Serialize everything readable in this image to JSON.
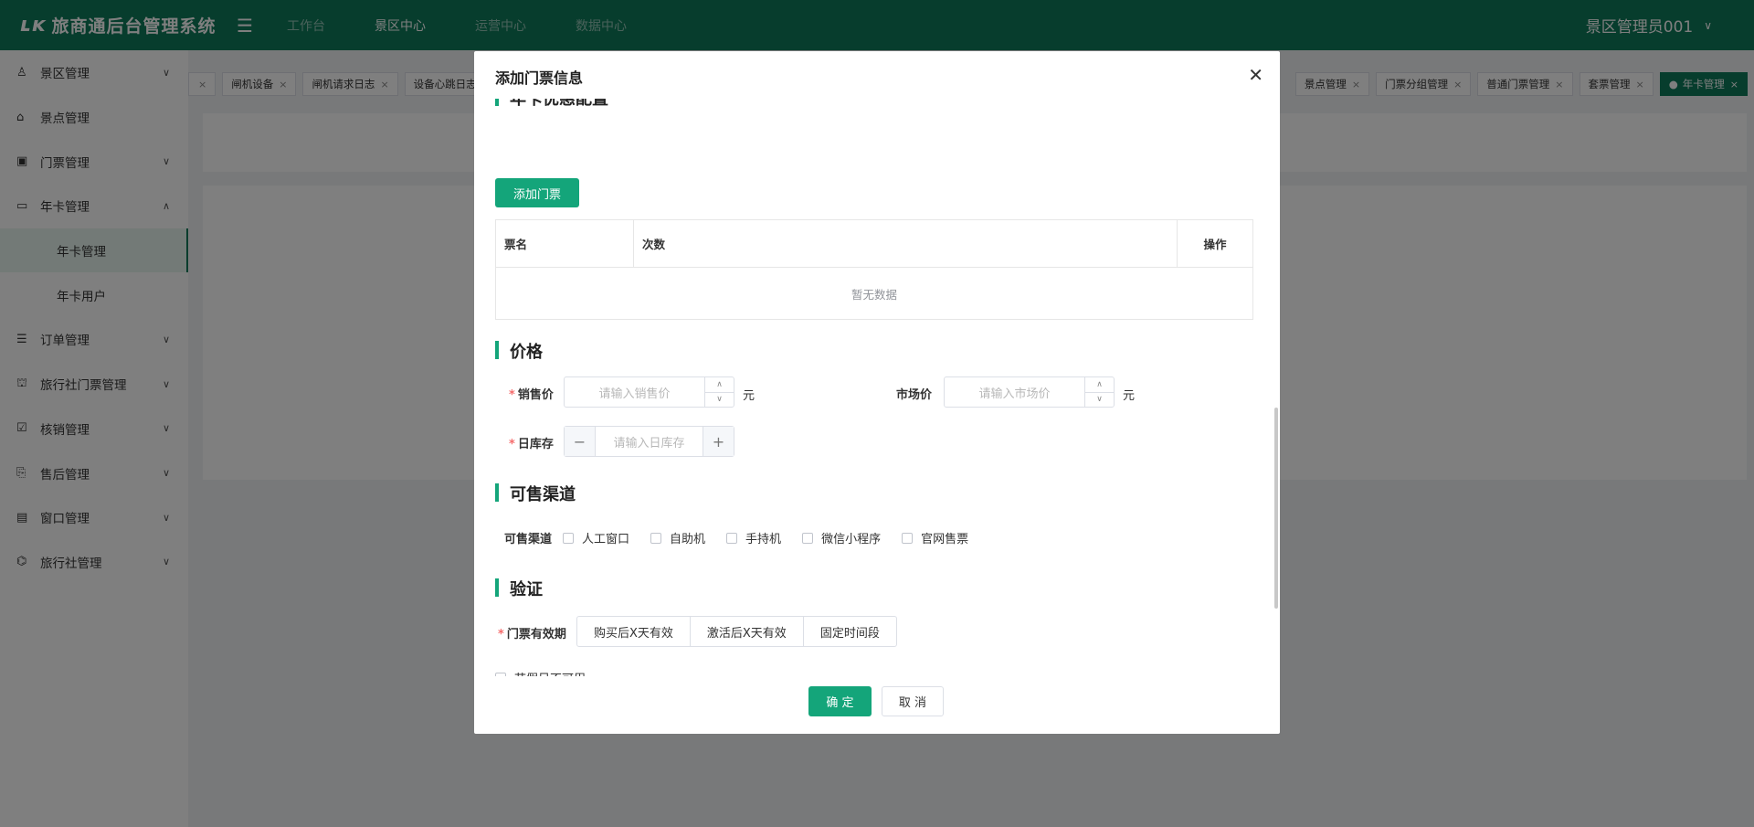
{
  "header": {
    "logo_mark": "ʟᴋ",
    "title": "旅商通后台管理系统",
    "nav": [
      "工作台",
      "景区中心",
      "运营中心",
      "数据中心"
    ],
    "user": "景区管理员001"
  },
  "sidebar": {
    "items": [
      {
        "label": "景区管理"
      },
      {
        "label": "景点管理"
      },
      {
        "label": "门票管理"
      },
      {
        "label": "年卡管理"
      },
      {
        "label": "年卡管理"
      },
      {
        "label": "年卡用户"
      },
      {
        "label": "订单管理"
      },
      {
        "label": "旅行社门票管理"
      },
      {
        "label": "核销管理"
      },
      {
        "label": "售后管理"
      },
      {
        "label": "窗口管理"
      },
      {
        "label": "旅行社管理"
      }
    ]
  },
  "tabs": {
    "left": [
      "闸机设备",
      "闸机请求日志",
      "设备心跳日志"
    ],
    "right": [
      "景点管理",
      "门票分组管理",
      "普通门票管理",
      "套票管理",
      "年卡管理"
    ]
  },
  "modal": {
    "title": "添加门票信息",
    "partial_section_title": "年卡优惠配置",
    "add_ticket_label": "添加门票",
    "table": {
      "headers": [
        "票名",
        "次数",
        "操作"
      ],
      "empty": "暂无数据"
    },
    "price": {
      "title": "价格",
      "sale_label": "销售价",
      "sale_placeholder": "请输入销售价",
      "market_label": "市场价",
      "market_placeholder": "请输入市场价",
      "unit": "元",
      "stock_label": "日库存",
      "stock_placeholder": "请输入日库存"
    },
    "channels": {
      "title": "可售渠道",
      "label": "可售渠道",
      "options": [
        "人工窗口",
        "自助机",
        "手持机",
        "微信小程序",
        "官网售票"
      ]
    },
    "verify": {
      "title": "验证",
      "validity_label": "门票有效期",
      "options": [
        "购买后X天有效",
        "激活后X天有效",
        "固定时间段"
      ],
      "holiday_label": "节假日不可用"
    },
    "confirm_label": "确 定",
    "cancel_label": "取 消"
  },
  "colors": {
    "brand": "#0f7a5a",
    "accent": "#14a57a"
  }
}
